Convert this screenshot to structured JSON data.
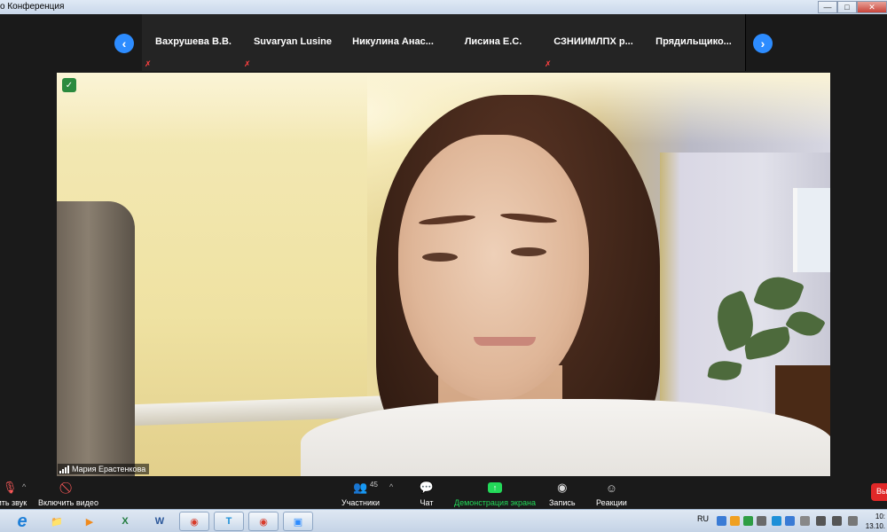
{
  "window": {
    "title": "о Конференция",
    "buttons": {
      "minimize": "—",
      "maximize": "□",
      "close": "✕"
    }
  },
  "gallery": {
    "participants": [
      {
        "name": "Вахрушева В.В.",
        "muted": true
      },
      {
        "name": "Suvaryan Lusine",
        "muted": true
      },
      {
        "name": "Никулина  Анас...",
        "muted": false
      },
      {
        "name": "Лисина Е.С.",
        "muted": false
      },
      {
        "name": "СЗНИИМЛПХ р...",
        "muted": true
      },
      {
        "name": "Прядильщико...",
        "muted": false
      }
    ],
    "prev": "‹",
    "next": "›"
  },
  "speaker": {
    "name": "Мария Ерастенкова"
  },
  "toolbar": {
    "audio_label": "чить звук",
    "video_label": "Включить видео",
    "participants_label": "Участники",
    "participants_count": "45",
    "chat_label": "Чат",
    "share_label": "Демонстрация экрана",
    "record_label": "Запись",
    "reactions_label": "Реакции",
    "leave_label": "Вы"
  },
  "taskbar": {
    "apps": [
      "e",
      "📁",
      "▶",
      "X",
      "W",
      "◉",
      "T",
      "◉",
      "▣"
    ],
    "language": "RU",
    "time": "10:",
    "date": "13.10."
  },
  "colors": {
    "accent": "#2d8cff",
    "share_green": "#23d959",
    "leave_red": "#e02828",
    "muted_red": "#ff4040"
  }
}
